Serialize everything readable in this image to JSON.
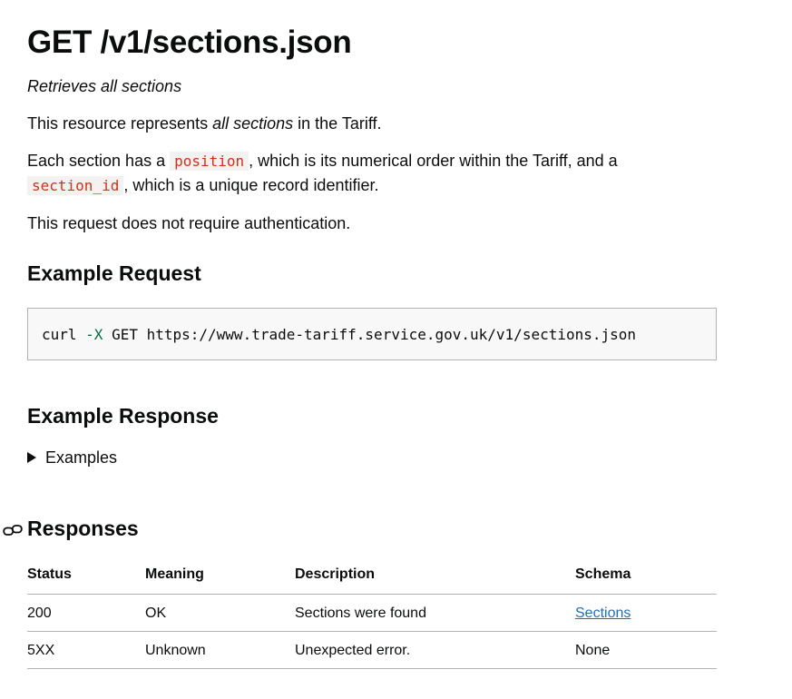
{
  "header": {
    "title": "GET /v1/sections.json",
    "tagline": "Retrieves all sections"
  },
  "intro": {
    "p1_before": "This resource represents ",
    "p1_em": "all sections",
    "p1_after": " in the Tariff.",
    "p2_before": "Each section has a ",
    "p2_code1": "position",
    "p2_middle": ", which is its numerical order within the Tariff, and a ",
    "p2_code2": "section_id",
    "p2_after": ", which is a unique record identifier.",
    "p3": "This request does not require authentication."
  },
  "request": {
    "heading": "Example Request",
    "cmd": "curl ",
    "flag": "-X",
    "rest": " GET https://www.trade-tariff.service.gov.uk/v1/sections.json"
  },
  "response": {
    "heading": "Example Response",
    "summary": "Examples"
  },
  "responses": {
    "heading": "Responses",
    "columns": [
      "Status",
      "Meaning",
      "Description",
      "Schema"
    ],
    "rows": [
      {
        "status": "200",
        "meaning": "OK",
        "description": "Sections were found",
        "schema": "Sections"
      },
      {
        "status": "5XX",
        "meaning": "Unknown",
        "description": "Unexpected error.",
        "schema": "None"
      }
    ]
  },
  "icons": {
    "anchor": "link-icon",
    "details": "triangle-right-icon"
  },
  "colors": {
    "code_text": "#d13118",
    "code_bg": "#f3f2f1",
    "link": "#1d70b8",
    "flag": "#00703c",
    "border": "#b1b4b6"
  }
}
